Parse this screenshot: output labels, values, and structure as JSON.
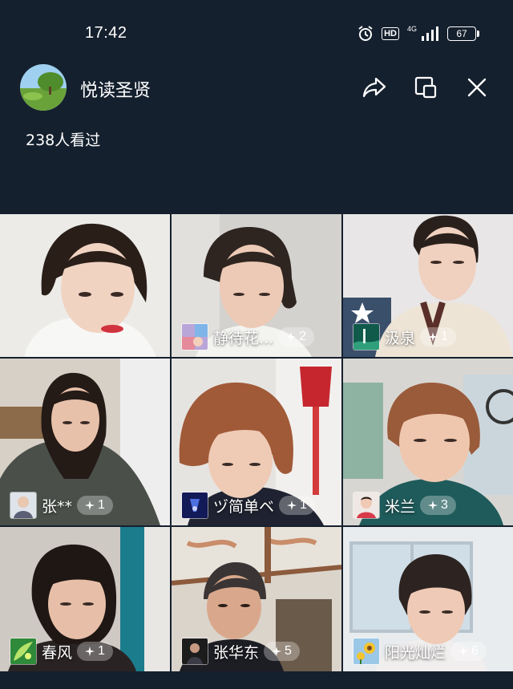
{
  "status_bar": {
    "time": "17:42",
    "alarm_icon": "alarm-icon",
    "hd_label": "HD",
    "network_label": "4G",
    "battery_level": "67"
  },
  "header": {
    "room_name": "悦读圣贤",
    "viewers": "238人看过",
    "share_icon": "share-icon",
    "minimize_icon": "pip-window-icon",
    "close_icon": "close-icon"
  },
  "participants": [
    {
      "name": "",
      "likes": ""
    },
    {
      "name": "静待花...",
      "likes": "2"
    },
    {
      "name": "汲泉",
      "likes": "1"
    },
    {
      "name": "张**",
      "likes": "1"
    },
    {
      "name": "ヅ简单ベ",
      "likes": "1"
    },
    {
      "name": "米兰",
      "likes": "3"
    },
    {
      "name": "春风",
      "likes": "1"
    },
    {
      "name": "张华东",
      "likes": "5"
    },
    {
      "name": "阳光灿烂",
      "likes": "6"
    }
  ],
  "like_icon": "sparkle-icon",
  "colors": {
    "background": "#15202e",
    "pill": "rgba(255,255,255,0.30)"
  }
}
